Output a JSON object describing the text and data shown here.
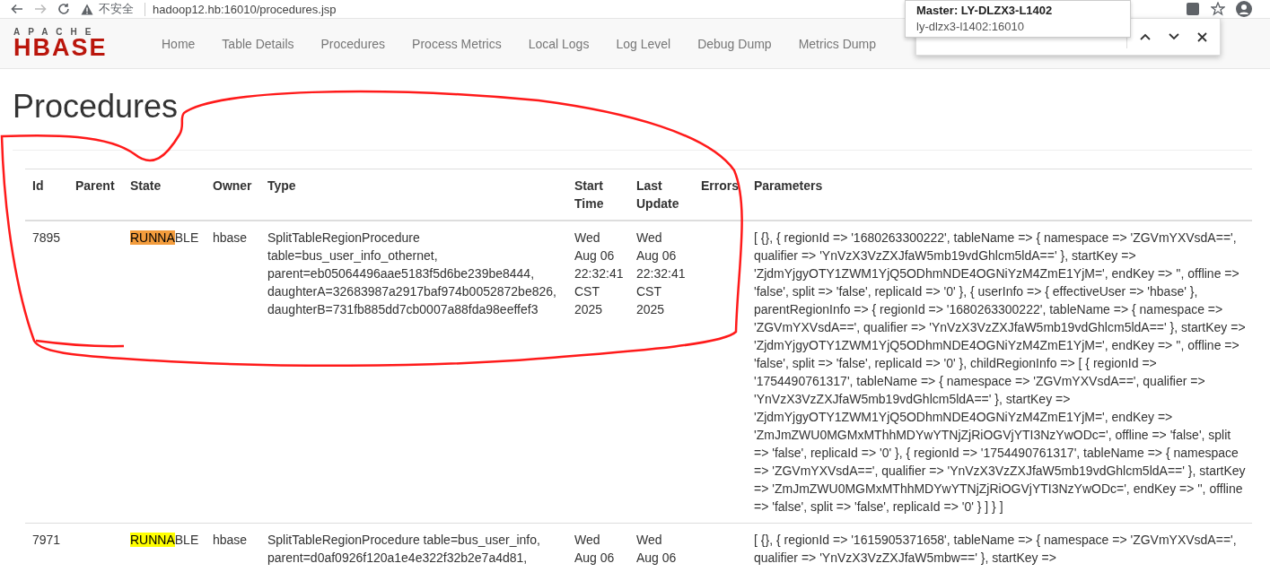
{
  "browser": {
    "security_label": "不安全",
    "url": "hadoop12.hb:16010/procedures.jsp"
  },
  "logo": {
    "top": "APACHE",
    "main": "HBASE"
  },
  "nav": [
    "Home",
    "Table Details",
    "Procedures",
    "Process Metrics",
    "Local Logs",
    "Log Level",
    "Debug Dump",
    "Metrics Dump"
  ],
  "host_tooltip": {
    "title": "Master: LY-DLZX3-L1402",
    "address": "ly-dlzx3-l1402:16010"
  },
  "heading": "Procedures",
  "table": {
    "columns": [
      "Id",
      "Parent",
      "State",
      "Owner",
      "Type",
      "Start Time",
      "Last Update",
      "Errors",
      "Parameters"
    ],
    "rows": [
      {
        "id": "7895",
        "state": {
          "match": "RUNNA",
          "rest": "BLE",
          "current_match": true
        },
        "owner": "hbase",
        "type": "SplitTableRegionProcedure table=bus_user_info_othernet, parent=eb05064496aae5183f5d6be239be8444, daughterA=32683987a2917baf974b0052872be826, daughterB=731fb885dd7cb0007a88fda98eeffef3",
        "start_time": "Wed Aug 06 22:32:41 CST 2025",
        "last_update": "Wed Aug 06 22:32:41 CST 2025",
        "parameters": "[ {}, { regionId => '1680263300222', tableName => { namespace => 'ZGVmYXVsdA==', qualifier => 'YnVzX3VzZXJfaW5mb19vdGhlcm5ldA==' }, startKey => 'ZjdmYjgyOTY1ZWM1YjQ5ODhmNDE4OGNiYzM4ZmE1YjM=', endKey => '', offline => 'false', split => 'false', replicaId => '0' }, { userInfo => { effectiveUser => 'hbase' }, parentRegionInfo => { regionId => '1680263300222', tableName => { namespace => 'ZGVmYXVsdA==', qualifier => 'YnVzX3VzZXJfaW5mb19vdGhlcm5ldA==' }, startKey => 'ZjdmYjgyOTY1ZWM1YjQ5ODhmNDE4OGNiYzM4ZmE1YjM=', endKey => '', offline => 'false', split => 'false', replicaId => '0' }, childRegionInfo => [ { regionId => '1754490761317', tableName => { namespace => 'ZGVmYXVsdA==', qualifier => 'YnVzX3VzZXJfaW5mb19vdGhlcm5ldA==' }, startKey => 'ZjdmYjgyOTY1ZWM1YjQ5ODhmNDE4OGNiYzM4ZmE1YjM=', endKey => 'ZmJmZWU0MGMxMThhMDYwYTNjZjRiOGVjYTI3NzYwODc=', offline => 'false', split => 'false', replicaId => '0' }, { regionId => '1754490761317', tableName => { namespace => 'ZGVmYXVsdA==', qualifier => 'YnVzX3VzZXJfaW5mb19vdGhlcm5ldA==' }, startKey => 'ZmJmZWU0MGMxMThhMDYwYTNjZjRiOGVjYTI3NzYwODc=', endKey => '', offline => 'false', split => 'false', replicaId => '0' } ] } ]"
      },
      {
        "id": "7971",
        "state": {
          "match": "RUNNA",
          "rest": "BLE",
          "current_match": false
        },
        "owner": "hbase",
        "type": "SplitTableRegionProcedure table=bus_user_info, parent=d0af0926f120a1e4e322f32b2e7a4d81,",
        "start_time": "Wed Aug 06",
        "last_update": "Wed Aug 06",
        "parameters": "[ {}, { regionId => '1615905371658', tableName => { namespace => 'ZGVmYXVsdA==', qualifier => 'YnVzX3VzZXJfaW5mbw==' }, startKey =>"
      }
    ]
  }
}
